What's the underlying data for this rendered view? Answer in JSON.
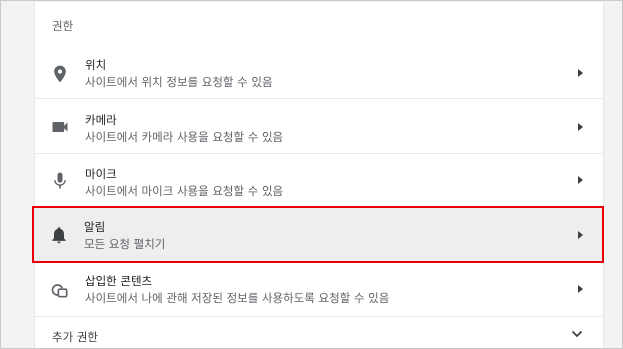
{
  "section": {
    "title": "권한"
  },
  "permissions": [
    {
      "title": "위치",
      "subtitle": "사이트에서 위치 정보를 요청할 수 있음",
      "icon": "location-pin-icon"
    },
    {
      "title": "카메라",
      "subtitle": "사이트에서 카메라 사용을 요청할 수 있음",
      "icon": "camera-icon"
    },
    {
      "title": "마이크",
      "subtitle": "사이트에서 마이크 사용을 요청할 수 있음",
      "icon": "microphone-icon"
    },
    {
      "title": "알림",
      "subtitle": "모든 요청 펼치기",
      "icon": "bell-icon"
    },
    {
      "title": "삽입한 콘텐츠",
      "subtitle": "사이트에서 나에 관해 저장된 정보를 사용하도록 요청할 수 있음",
      "icon": "embedded-content-icon"
    }
  ],
  "more": {
    "label": "추가 권한"
  },
  "colors": {
    "highlight_border": "#e8000b",
    "highlight_bg": "#eeeeee"
  }
}
